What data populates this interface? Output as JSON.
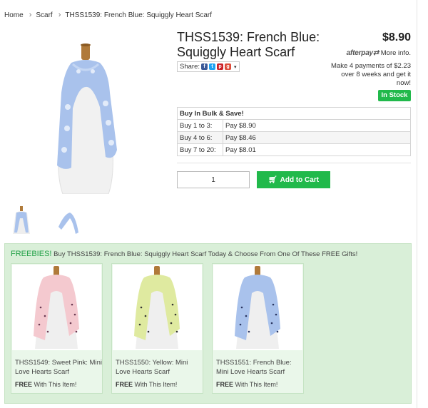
{
  "breadcrumb": {
    "home": "Home",
    "category": "Scarf",
    "current": "THSS1539: French Blue: Squiggly Heart Scarf"
  },
  "product": {
    "title": "THSS1539: French Blue: Squiggly Heart Scarf",
    "price": "$8.90",
    "afterpay_logo": "afterpay",
    "afterpay_more": "More info.",
    "afterpay_desc": "Make 4 payments of $2.23 over 8 weeks and get it now!",
    "stock": "In Stock",
    "share_label": "Share:",
    "quantity": "1",
    "add_to_cart": "Add to Cart",
    "colors": {
      "scarf": "#a9c2ec",
      "accent": "#21b94b"
    }
  },
  "bulk": {
    "heading": "Buy In Bulk & Save!",
    "rows": [
      {
        "qty": "Buy 1 to 3:",
        "price": "Pay $8.90"
      },
      {
        "qty": "Buy 4 to 6:",
        "price": "Pay $8.46"
      },
      {
        "qty": "Buy 7 to 20:",
        "price": "Pay $8.01"
      }
    ]
  },
  "freebies": {
    "label": "FREEBIES!",
    "text_a": "Buy THSS1539: French Blue: Squiggly Heart Scarf Today & Choose From One Of These",
    "free_word": "FREE",
    "text_b": "Gifts!",
    "items": [
      {
        "name": "THSS1549: Sweet Pink: Mini Love Hearts Scarf",
        "free": "FREE",
        "with": "With This Item!",
        "color": "#f4c9cf"
      },
      {
        "name": "THSS1550: Yellow: Mini Love Hearts Scarf",
        "free": "FREE",
        "with": "With This Item!",
        "color": "#dfeaa0"
      },
      {
        "name": "THSS1551: French Blue: Mini Love Hearts Scarf",
        "free": "FREE",
        "with": "With This Item!",
        "color": "#a9c2ec"
      }
    ]
  }
}
